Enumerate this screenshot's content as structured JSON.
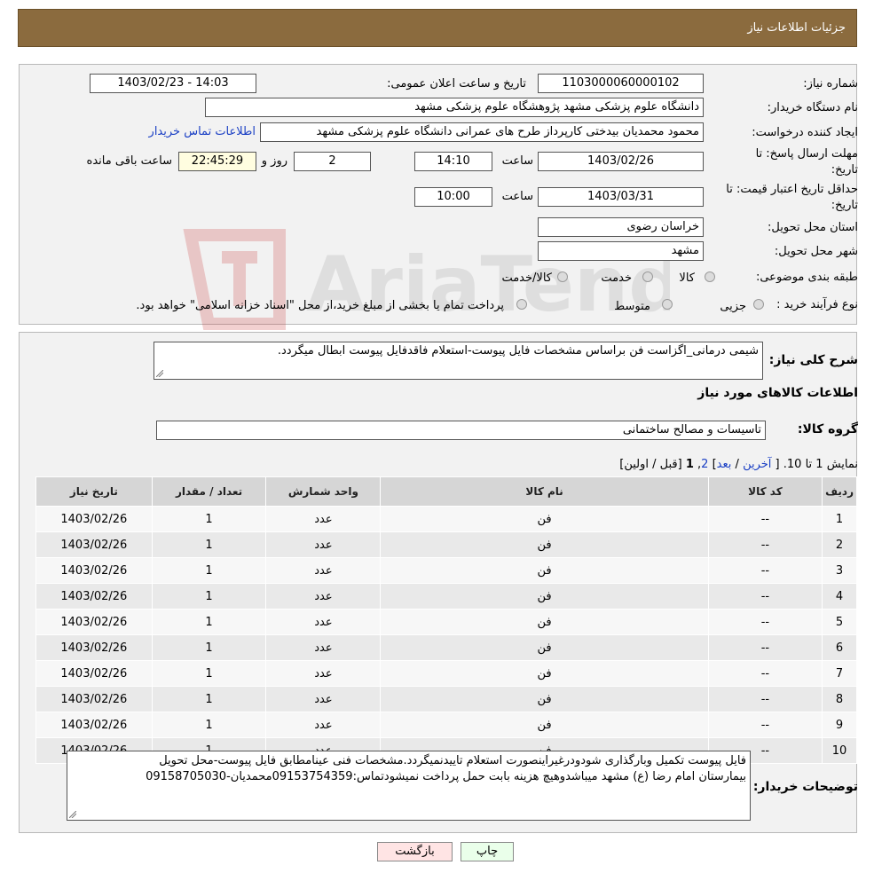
{
  "header": {
    "title": "جزئیات اطلاعات نیاز"
  },
  "form": {
    "need_number_label": "شماره نیاز:",
    "need_number": "1103000060000102",
    "announce_label": "تاریخ و ساعت اعلان عمومی:",
    "announce_value": "1403/02/23 - 14:03",
    "buyer_label": "نام دستگاه خریدار:",
    "buyer_value": "دانشگاه علوم پزشکی مشهد   پژوهشگاه علوم پزشکی مشهد",
    "creator_label": "ایجاد کننده درخواست:",
    "creator_value": "محمود محمدیان بیدختی کارپرداز طرح های عمرانی دانشگاه علوم پزشکی مشهد",
    "contact_link": "اطلاعات تماس خریدار",
    "deadline_label_1": "مهلت ارسال پاسخ: تا",
    "deadline_label_2": "تاریخ:",
    "deadline_date": "1403/02/26",
    "time_label": "ساعت",
    "deadline_time": "14:10",
    "days_value": "2",
    "days_label": "روز و",
    "remaining_time": "22:45:29",
    "remaining_label": "ساعت باقی مانده",
    "validity_label_1": "حداقل تاریخ اعتبار قیمت: تا",
    "validity_label_2": "تاریخ:",
    "validity_date": "1403/03/31",
    "validity_time_label": "ساعت",
    "validity_time": "10:00",
    "province_label": "استان محل تحویل:",
    "province_value": "خراسان رضوی",
    "city_label": "شهر محل تحویل:",
    "city_value": "مشهد",
    "category_label": "طبقه بندی موضوعی:",
    "category_options": [
      "کالا",
      "خدمت",
      "کالا/خدمت"
    ],
    "process_label": "نوع فرآیند خرید :",
    "process_options": [
      "جزیی",
      "متوسط"
    ],
    "process_note": "پرداخت تمام یا بخشی از مبلغ خرید،از محل \"اسناد خزانه اسلامی\" خواهد بود."
  },
  "description": {
    "label": "شرح کلی نیاز:",
    "value": "شیمی درمانی_اگزاست فن براساس مشخصات فایل پیوست-استعلام فاقدفایل پیوست ابطال میگردد."
  },
  "goods": {
    "section_title": "اطلاعات کالاهای مورد نیاز",
    "group_label": "گروه کالا:",
    "group_value": "تاسیسات و مصالح ساختمانی",
    "pagination": {
      "prefix": "نمایش 1 تا 10.",
      "open": "[",
      "last": "آخرین",
      "sep": "/",
      "next": "بعد",
      "page2": "2",
      "comma": ",",
      "page1": "1",
      "rest": "[قبل / اولین]"
    },
    "columns": [
      "ردیف",
      "کد کالا",
      "نام کالا",
      "واحد شمارش",
      "تعداد / مقدار",
      "تاریخ نیاز"
    ],
    "rows": [
      {
        "idx": "1",
        "code": "--",
        "name": "فن",
        "unit": "عدد",
        "qty": "1",
        "date": "1403/02/26"
      },
      {
        "idx": "2",
        "code": "--",
        "name": "فن",
        "unit": "عدد",
        "qty": "1",
        "date": "1403/02/26"
      },
      {
        "idx": "3",
        "code": "--",
        "name": "فن",
        "unit": "عدد",
        "qty": "1",
        "date": "1403/02/26"
      },
      {
        "idx": "4",
        "code": "--",
        "name": "فن",
        "unit": "عدد",
        "qty": "1",
        "date": "1403/02/26"
      },
      {
        "idx": "5",
        "code": "--",
        "name": "فن",
        "unit": "عدد",
        "qty": "1",
        "date": "1403/02/26"
      },
      {
        "idx": "6",
        "code": "--",
        "name": "فن",
        "unit": "عدد",
        "qty": "1",
        "date": "1403/02/26"
      },
      {
        "idx": "7",
        "code": "--",
        "name": "فن",
        "unit": "عدد",
        "qty": "1",
        "date": "1403/02/26"
      },
      {
        "idx": "8",
        "code": "--",
        "name": "فن",
        "unit": "عدد",
        "qty": "1",
        "date": "1403/02/26"
      },
      {
        "idx": "9",
        "code": "--",
        "name": "فن",
        "unit": "عدد",
        "qty": "1",
        "date": "1403/02/26"
      },
      {
        "idx": "10",
        "code": "--",
        "name": "فن",
        "unit": "عدد",
        "qty": "1",
        "date": "1403/02/26"
      }
    ]
  },
  "buyer_notes": {
    "label": "توضیحات خریدار:",
    "line1": "فایل پیوست تکمیل وبارگذاری شودودرغیراینصورت استعلام تاییدنمیگردد.مشخصات فنی عینامطابق فایل پیوست-محل تحویل",
    "line2": "بیمارستان امام رضا (ع) مشهد میباشدوهیچ هزینه بابت حمل پرداخت نمیشودتماس:09153754359محمدیان-09158705030"
  },
  "buttons": {
    "print": "چاپ",
    "back": "بازگشت"
  },
  "watermark": {
    "text": "AriaTender.neT"
  },
  "colors": {
    "header_bg": "#8b6b3e",
    "link": "#1a3fc4",
    "back_button_bg": "#ffe4e4",
    "print_button_bg": "#eaffea"
  }
}
